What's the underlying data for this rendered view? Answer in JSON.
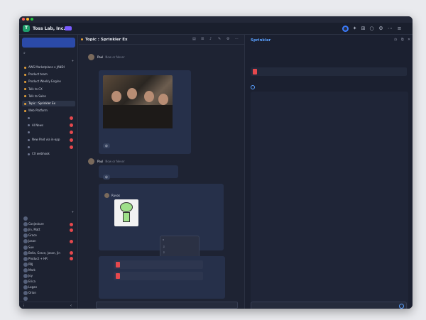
{
  "window": {
    "title": ""
  },
  "header": {
    "team_name": "Toss Lab, Inc.",
    "team_badge": ""
  },
  "sidebar": {
    "promo": "",
    "search_label": "",
    "topics_header": "",
    "items": [
      {
        "label": "AWS Marketplace x JANDI",
        "indent": false,
        "badge": false
      },
      {
        "label": "Product team",
        "indent": false,
        "badge": false
      },
      {
        "label": "Product Weekly Engine",
        "indent": false,
        "badge": false
      },
      {
        "label": "Talk to CX",
        "indent": false,
        "badge": false
      },
      {
        "label": "Talk to Sales",
        "indent": false,
        "badge": false
      },
      {
        "label": "Topic : Sprinkler Ex",
        "indent": false,
        "badge": false,
        "active": true
      },
      {
        "label": "Web Platform",
        "indent": false,
        "badge": false
      },
      {
        "label": "",
        "indent": true,
        "badge": true
      },
      {
        "label": "AI News",
        "indent": true,
        "badge": true
      },
      {
        "label": "",
        "indent": true,
        "badge": true
      },
      {
        "label": "New Paid via in-app",
        "indent": true,
        "badge": true
      },
      {
        "label": "",
        "indent": true,
        "badge": true
      },
      {
        "label": "CX webhook",
        "indent": true,
        "badge": false
      }
    ],
    "dm_header": "",
    "dms": [
      {
        "label": "",
        "badge": false
      },
      {
        "label": "Conjecture",
        "badge": true
      },
      {
        "label": "Jin, Matt",
        "badge": true
      },
      {
        "label": "Grace",
        "badge": false
      },
      {
        "label": "Jason",
        "badge": true
      },
      {
        "label": "Sue",
        "badge": false
      },
      {
        "label": "Bella, Grace, Jason, Jin",
        "badge": true
      },
      {
        "label": "Product + HR",
        "badge": true
      },
      {
        "label": "PBJ",
        "badge": false
      },
      {
        "label": "Mark",
        "badge": false
      },
      {
        "label": "Joy",
        "badge": false
      },
      {
        "label": "Erica",
        "badge": false
      },
      {
        "label": "Logan",
        "badge": false
      },
      {
        "label": "Orion",
        "badge": false
      },
      {
        "label": "",
        "badge": false
      }
    ]
  },
  "chat": {
    "topic_title": "Topic : Sprinkler Ex",
    "date_chip": "",
    "messages": [
      {
        "author": "Paul",
        "meta": "Now or Never"
      },
      {
        "author": "Paul",
        "meta": "Now or Never",
        "text": ""
      },
      {
        "reply_label": ""
      }
    ],
    "reply_author": "Ruvos",
    "context_menu": [
      {
        "label": "",
        "icon": "speech-icon"
      },
      {
        "label": "",
        "icon": "download-icon"
      },
      {
        "label": "",
        "icon": "download-icon"
      },
      {
        "label": "",
        "icon": "star-icon"
      },
      {
        "label": "",
        "icon": "pin-icon"
      },
      {
        "label": "",
        "icon": "summary-icon",
        "highlighted": true
      }
    ],
    "files": [
      {
        "name": ""
      },
      {
        "name": ""
      }
    ],
    "composer_placeholder": "",
    "composer_hint": ""
  },
  "right": {
    "title": "Sprinkler",
    "file_label": "",
    "file_name": "",
    "summary_label": "",
    "summary_lines": [
      "",
      "",
      "",
      "",
      "",
      "",
      "",
      "",
      "",
      "",
      "",
      "",
      "",
      "",
      "",
      "",
      "",
      "",
      "",
      "",
      "",
      "",
      "",
      "",
      "",
      "",
      "",
      "",
      "",
      "",
      "",
      "",
      "",
      "",
      "",
      "",
      "",
      "",
      "",
      "",
      "",
      "",
      "",
      "",
      "",
      "",
      "",
      "",
      "",
      "",
      "",
      ""
    ],
    "composer_placeholder": ""
  },
  "colors": {
    "accent": "#5aa0ff",
    "brand_green": "#1f9d6b",
    "badge_red": "#e5484d",
    "topic_orange": "#e7a23a"
  }
}
